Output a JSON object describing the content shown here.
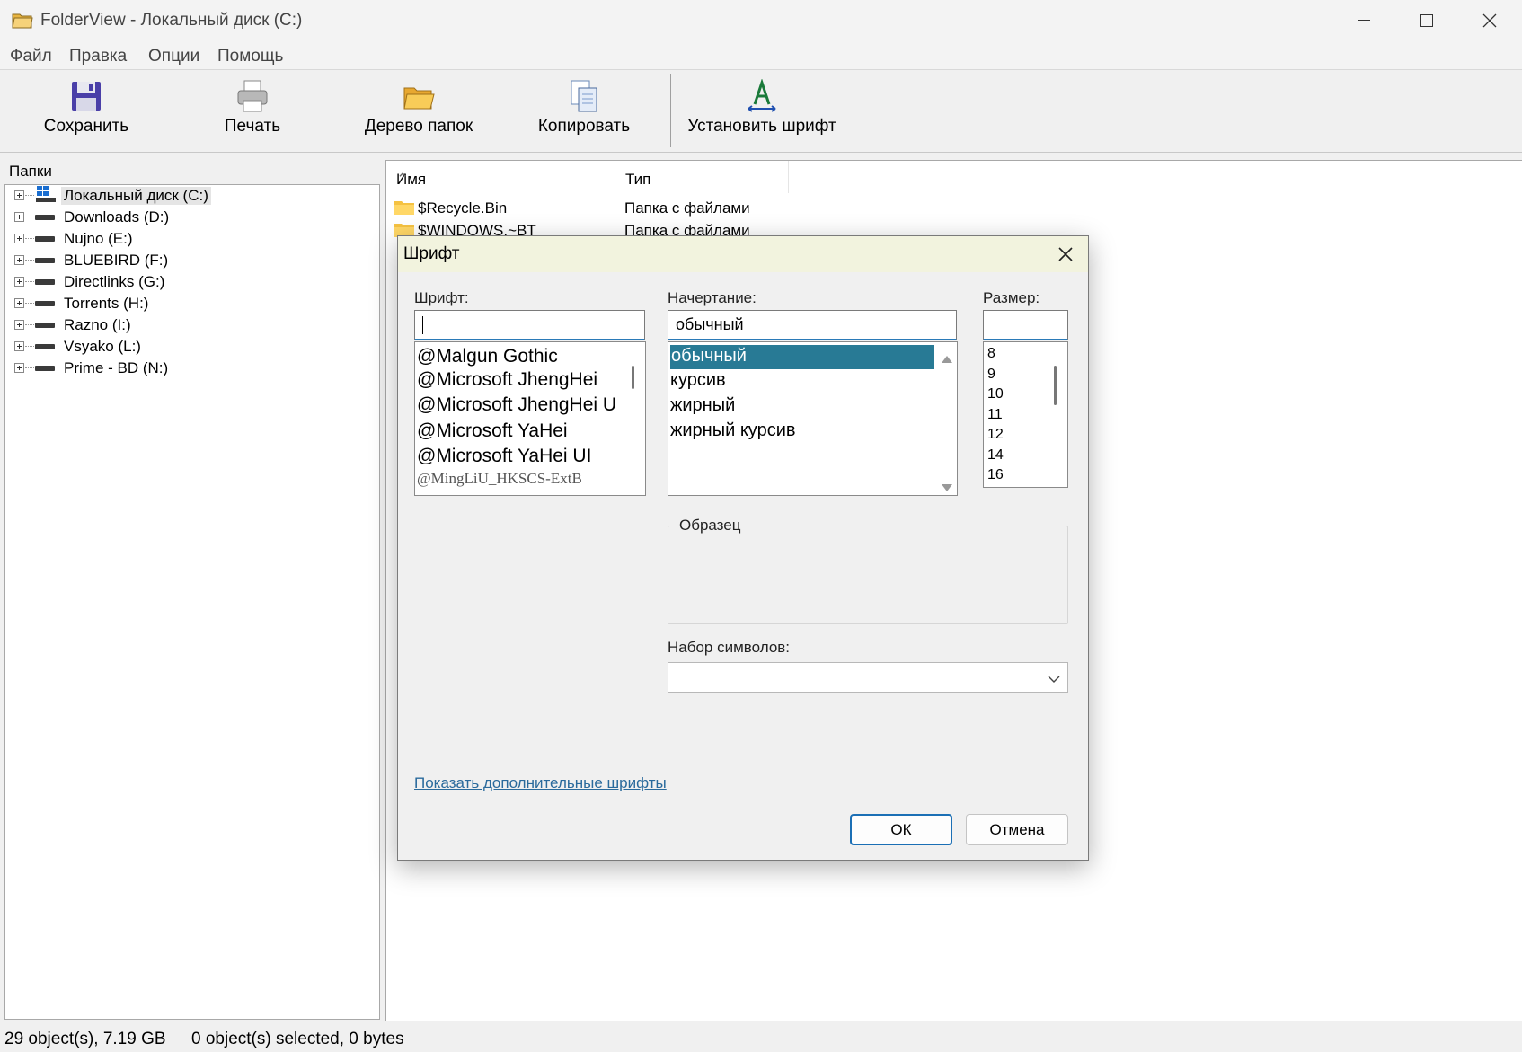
{
  "window": {
    "title": "FolderView - Локальный диск (C:)"
  },
  "menu": [
    "Файл",
    "Правка",
    "Опции",
    "Помощь"
  ],
  "toolbar": {
    "buttons": [
      {
        "label": "Сохранить",
        "icon": "save-icon"
      },
      {
        "label": "Печать",
        "icon": "printer-icon"
      },
      {
        "label": "Дерево папок",
        "icon": "folder-tree-icon"
      },
      {
        "label": "Копировать",
        "icon": "copy-icon"
      },
      {
        "label": "Установить шрифт",
        "icon": "font-icon"
      }
    ]
  },
  "left_pane": {
    "header": "Папки",
    "items": [
      {
        "label": "Локальный диск (C:)",
        "selected": true
      },
      {
        "label": "Downloads (D:)"
      },
      {
        "label": "Nujno (E:)"
      },
      {
        "label": "BLUEBIRD (F:)"
      },
      {
        "label": "Directlinks (G:)"
      },
      {
        "label": "Torrents (H:)"
      },
      {
        "label": "Razno (I:)"
      },
      {
        "label": "Vsyako (L:)"
      },
      {
        "label": "Prime - BD (N:)"
      }
    ]
  },
  "list": {
    "columns": [
      "Имя",
      "Тип"
    ],
    "rows": [
      {
        "name": "$Recycle.Bin",
        "type": "Папка с файлами"
      },
      {
        "name": "$WINDOWS.~BT",
        "type": "Папка с файлами"
      }
    ]
  },
  "status": {
    "objects": "29 object(s), 7.19 GB",
    "selected": "0 object(s) selected, 0 bytes"
  },
  "font_dialog": {
    "title": "Шрифт",
    "font_label": "Шрифт:",
    "font_value": "",
    "fonts": [
      "@Malgun Gothic",
      "@Microsoft JhengHei",
      "@Microsoft JhengHei U",
      "@Microsoft YaHei",
      "@Microsoft YaHei UI",
      "@MingLiU_HKSCS-ExtB"
    ],
    "style_label": "Начертание:",
    "style_value": "обычный",
    "styles": [
      "обычный",
      "курсив",
      "жирный",
      "жирный курсив"
    ],
    "size_label": "Размер:",
    "size_value": "",
    "sizes": [
      "8",
      "9",
      "10",
      "11",
      "12",
      "14",
      "16"
    ],
    "sample_label": "Образец",
    "charset_label": "Набор символов:",
    "charset_value": "",
    "more_fonts_link": "Показать дополнительные шрифты",
    "ok_label": "ОК",
    "cancel_label": "Отмена"
  },
  "colors": {
    "selection": "#287a95",
    "link": "#2a6a9c",
    "dialog_title_bg": "#f2f3de",
    "focus_border": "#2a7ab8"
  }
}
